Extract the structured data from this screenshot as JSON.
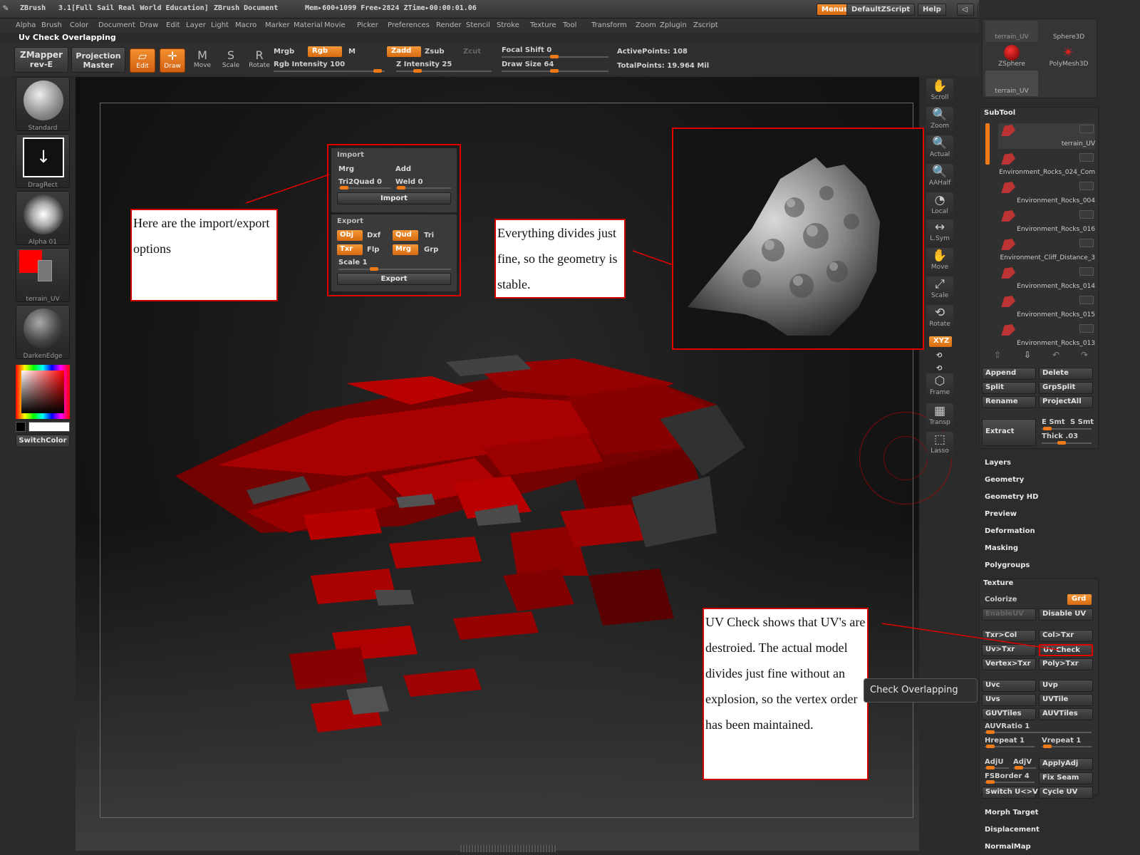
{
  "titlebar": {
    "app": "ZBrush",
    "version": "3.1[Full Sail Real World Education]",
    "doc": "ZBrush Document",
    "mem": "Mem▸600+1099 Free▸2824 ZTime▸00:00:01.06",
    "menus_btn": "Menus",
    "script_btn": "DefaultZScript",
    "help_btn": "Help"
  },
  "menubar": [
    "Alpha",
    "Brush",
    "Color",
    "Document",
    "Draw",
    "Edit",
    "Layer",
    "Light",
    "Macro",
    "Marker",
    "Material",
    "Movie",
    "Picker",
    "Preferences",
    "Render",
    "Stencil",
    "Stroke",
    "Texture",
    "Tool",
    "Transform",
    "Zoom",
    "Zplugin",
    "Zscript"
  ],
  "breadcrumb": "Uv Check Overlapping",
  "shelf": {
    "zmapper": "ZMapper rev-E",
    "zmapper_l1": "ZMapper",
    "zmapper_l2": "rev-E",
    "projection_l1": "Projection",
    "projection_l2": "Master",
    "tools": [
      {
        "label": "Edit",
        "icon": "edit-icon",
        "on": true
      },
      {
        "label": "Draw",
        "icon": "draw-icon",
        "on": true
      },
      {
        "label": "Move",
        "icon": "move-icon",
        "on": false
      },
      {
        "label": "Scale",
        "icon": "scale-icon",
        "on": false
      },
      {
        "label": "Rotate",
        "icon": "rotate-icon",
        "on": false
      }
    ],
    "mrgb": "Mrgb",
    "rgb": "Rgb",
    "m": "M",
    "rgb_intensity": "Rgb Intensity 100",
    "zadd": "Zadd",
    "zsub": "Zsub",
    "zcut": "Zcut",
    "z_intensity": "Z Intensity 25",
    "focal_shift": "Focal Shift 0",
    "draw_size": "Draw Size 64",
    "active_points": "ActivePoints: 108",
    "total_points": "TotalPoints: 19.964 Mil"
  },
  "lefttray": {
    "brush": "Standard",
    "stroke": "DragRect",
    "alpha": "Alpha 01",
    "texture": "terrain_UV",
    "material": "DarkenEdge",
    "switch": "SwitchColor",
    "main_color": "#ff0000"
  },
  "righttools": [
    "Scroll",
    "Zoom",
    "Actual",
    "AAHalf",
    "Local",
    "L.Sym",
    "Move",
    "Scale",
    "Rotate",
    "Frame",
    "Transp",
    "Lasso"
  ],
  "xyz": "XYZ",
  "rightpanel": {
    "toolthumbs": [
      "terrain_UV",
      "Sphere3D",
      "ZSphere",
      "PolyMesh3D",
      "terrain_UV"
    ],
    "subtool_head": "SubTool",
    "subtools": [
      "terrain_UV",
      "Environment_Rocks_024_Com",
      "Environment_Rocks_004",
      "Environment_Rocks_016",
      "Environment_Cliff_Distance_3",
      "Environment_Rocks_014",
      "Environment_Rocks_015",
      "Environment_Rocks_013"
    ],
    "append": "Append",
    "delete": "Delete",
    "split": "Split",
    "grpsplit": "GrpSplit",
    "rename": "Rename",
    "projectall": "ProjectAll",
    "extract": "Extract",
    "esmt": "E Smt",
    "ssmt": "S Smt",
    "thick": "Thick .03",
    "sections": [
      "Layers",
      "Geometry",
      "Geometry HD",
      "Preview",
      "Deformation",
      "Masking",
      "Polygroups"
    ],
    "texture_head": "Texture",
    "colorize": "Colorize",
    "grd": "Grd",
    "enableuv": "EnableUV",
    "disableuv": "Disable UV",
    "txr_col": "Txr>Col",
    "col_txr": "Col>Txr",
    "uv_txr": "Uv>Txr",
    "uv_check": "Uv Check",
    "vertex_txr": "Vertex>Txr",
    "poly_txr": "Poly>Txr",
    "uvc": "Uvc",
    "uvp": "Uvp",
    "uvs": "Uvs",
    "uvtile": "UVTile",
    "guvtiles": "GUVTiles",
    "auvtiles": "AUVTiles",
    "auvratio": "AUVRatio 1",
    "hrepeat": "Hrepeat 1",
    "vrepeat": "Vrepeat 1",
    "adju": "AdjU",
    "adjv": "AdjV",
    "applyadj": "ApplyAdj",
    "fsborder": "FSBorder 4",
    "fixseam": "Fix Seam",
    "switchuv": "Switch U<>V",
    "cycleuv": "Cycle UV",
    "more_sections": [
      "Morph Target",
      "Displacement",
      "NormalMap"
    ]
  },
  "popup": {
    "import_head": "Import",
    "mrg": "Mrg",
    "add": "Add",
    "tri2quad": "Tri2Quad 0",
    "weld": "Weld 0",
    "import_btn": "Import",
    "export_head": "Export",
    "obj": "Obj",
    "dxf": "Dxf",
    "qud": "Qud",
    "tri": "Tri",
    "txr": "Txr",
    "flp": "Flp",
    "mrg2": "Mrg",
    "grp": "Grp",
    "scale": "Scale 1",
    "export_btn": "Export"
  },
  "notes": {
    "import_note": "Here are the import/export options",
    "divides_note": "Everything divides just fine, so the geometry is stable.",
    "uv_note": "UV Check shows that UV's are destroied.  The actual model divides just fine without an explosion, so the vertex order has been maintained."
  },
  "tooltip": "Check Overlapping",
  "colors": {
    "accent": "#f07a18",
    "annotation": "#e00000"
  }
}
